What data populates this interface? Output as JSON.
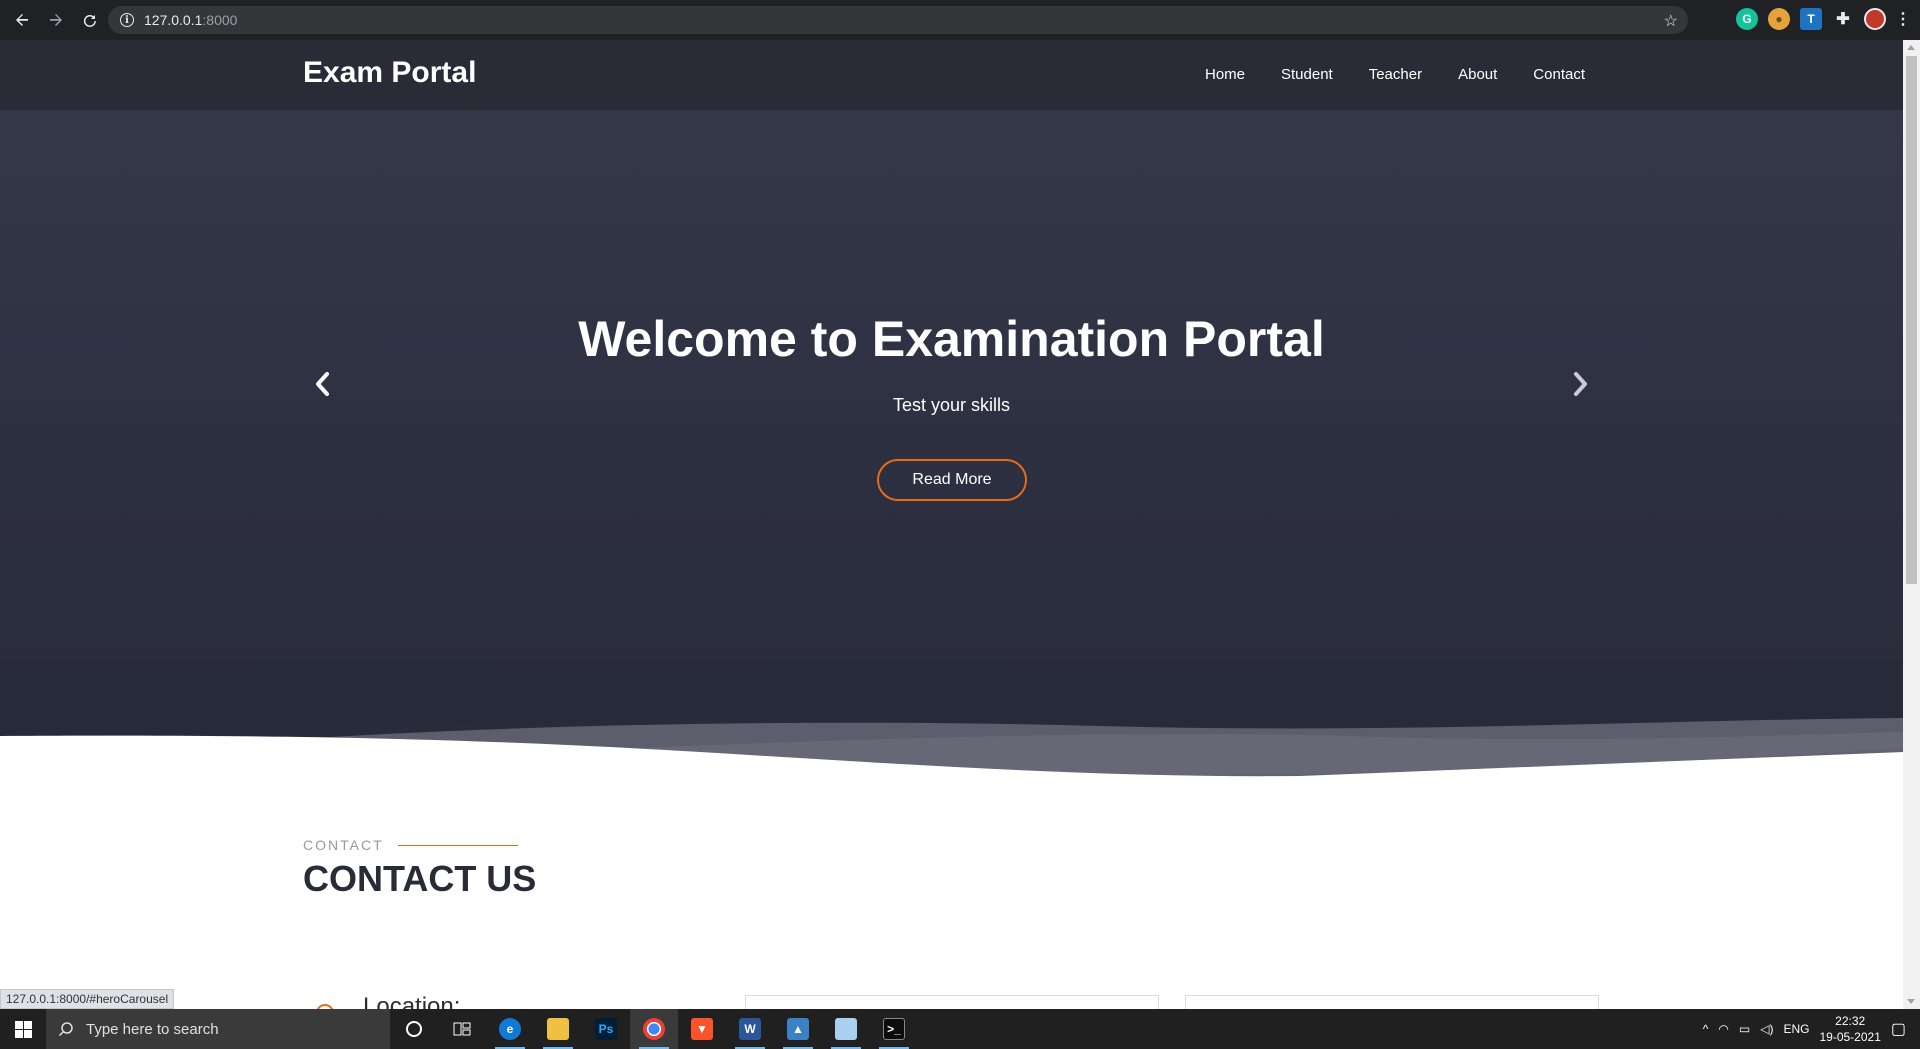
{
  "browser": {
    "url_host": "127.0.0.1",
    "url_port": ":8000"
  },
  "site": {
    "logo": "Exam Portal",
    "nav": [
      "Home",
      "Student",
      "Teacher",
      "About",
      "Contact"
    ]
  },
  "hero": {
    "title": "Welcome to Examination Portal",
    "subtitle": "Test your skills",
    "button": "Read More"
  },
  "contact": {
    "tag": "CONTACT",
    "title": "CONTACT US",
    "location_label": "Location:"
  },
  "status_bar": "127.0.0.1:8000/#heroCarousel",
  "taskbar": {
    "search_placeholder": "Type here to search",
    "language": "ENG",
    "time": "22:32",
    "date": "19-05-2021"
  },
  "colors": {
    "header_bg": "#2a2b36",
    "hero_bg": "#2c2f40",
    "accent": "#e96b16"
  }
}
